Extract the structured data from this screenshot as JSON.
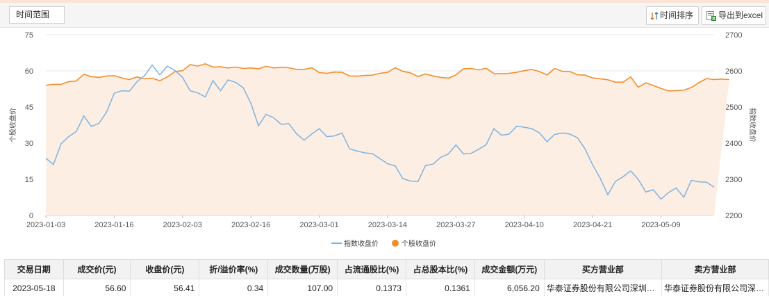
{
  "toolbar": {
    "range_label": "时间范围",
    "sort_label": "时间排序",
    "export_label": "导出到excel",
    "sort_icon": "sort-arrows-icon",
    "export_icon": "excel-export-icon"
  },
  "colors": {
    "index_line": "#7fb3e0",
    "stock_line": "#f28e2b",
    "area_fill": "#fdeee3",
    "grid": "#e8e8e8"
  },
  "chart_data": {
    "type": "line",
    "ylabel_left": "个股收盘价",
    "ylabel_right": "指数收盘价",
    "ylim_left": [
      0,
      75
    ],
    "ylim_right": [
      2200,
      2700
    ],
    "yticks_left": [
      "0",
      "15",
      "30",
      "45",
      "60",
      "75"
    ],
    "yticks_right": [
      "2200",
      "2300",
      "2400",
      "2500",
      "2600",
      "2700"
    ],
    "xtick_labels": [
      "2023-01-03",
      "2023-01-16",
      "2023-02-03",
      "2023-02-16",
      "2023-03-01",
      "2023-03-14",
      "2023-03-27",
      "2023-04-10",
      "2023-04-21",
      "2023-05-09"
    ],
    "xtick_index": [
      0,
      9,
      18,
      27,
      36,
      45,
      54,
      63,
      72,
      81
    ],
    "legend_position": "bottom-center",
    "grid": true,
    "series": [
      {
        "name": "指数收盘价",
        "axis": "right",
        "values": [
          2358,
          2341,
          2398,
          2418,
          2432,
          2475,
          2446,
          2455,
          2486,
          2538,
          2545,
          2544,
          2570,
          2587,
          2616,
          2589,
          2613,
          2601,
          2582,
          2545,
          2539,
          2528,
          2573,
          2545,
          2575,
          2568,
          2553,
          2510,
          2448,
          2480,
          2470,
          2452,
          2454,
          2426,
          2408,
          2425,
          2440,
          2418,
          2420,
          2428,
          2384,
          2378,
          2373,
          2371,
          2357,
          2343,
          2337,
          2302,
          2295,
          2294,
          2338,
          2342,
          2361,
          2370,
          2395,
          2370,
          2372,
          2383,
          2396,
          2440,
          2422,
          2425,
          2447,
          2444,
          2440,
          2428,
          2404,
          2424,
          2428,
          2425,
          2415,
          2384,
          2340,
          2303,
          2257,
          2294,
          2307,
          2323,
          2300,
          2265,
          2271,
          2245,
          2263,
          2276,
          2250,
          2297,
          2293,
          2292,
          2278
        ]
      },
      {
        "name": "个股收盘价",
        "axis": "left",
        "values": [
          54.0,
          54.4,
          54.4,
          55.5,
          55.8,
          58.6,
          57.6,
          57.3,
          57.9,
          58.0,
          57.1,
          56.4,
          57.5,
          56.7,
          57.0,
          55.9,
          57.5,
          59.7,
          60.1,
          62.6,
          62.0,
          62.9,
          61.6,
          61.7,
          61.2,
          61.6,
          61.0,
          61.2,
          60.9,
          61.9,
          61.2,
          61.5,
          61.3,
          60.6,
          60.6,
          61.3,
          59.3,
          59.0,
          59.5,
          59.4,
          57.9,
          57.8,
          58.1,
          58.2,
          59.0,
          59.4,
          61.3,
          59.8,
          59.2,
          57.7,
          58.7,
          57.9,
          57.3,
          57.0,
          58.3,
          60.9,
          61.0,
          60.4,
          61.1,
          58.9,
          58.8,
          59.0,
          59.4,
          60.1,
          60.6,
          59.7,
          58.3,
          61.0,
          59.8,
          59.7,
          58.4,
          58.2,
          57.1,
          56.7,
          56.3,
          55.3,
          55.3,
          57.5,
          53.2,
          55.0,
          53.9,
          52.7,
          51.7,
          51.8,
          52.0,
          53.1,
          55.1,
          56.8,
          56.4,
          56.6,
          56.4
        ]
      }
    ]
  },
  "table": {
    "headers": [
      "交易日期",
      "成交价(元)",
      "收盘价(元)",
      "折/溢价率(%)",
      "成交数量(万股)",
      "占流通股比(%)",
      "占总股本比(%)",
      "成交金额(万元)",
      "买方营业部",
      "卖方营业部"
    ],
    "rows": [
      [
        "2023-05-18",
        "56.60",
        "56.41",
        "0.34",
        "107.00",
        "0.1373",
        "0.1361",
        "6,056.20",
        "华泰证券股份有限公司深圳…",
        "华泰证券股份有限公司深…"
      ]
    ]
  }
}
